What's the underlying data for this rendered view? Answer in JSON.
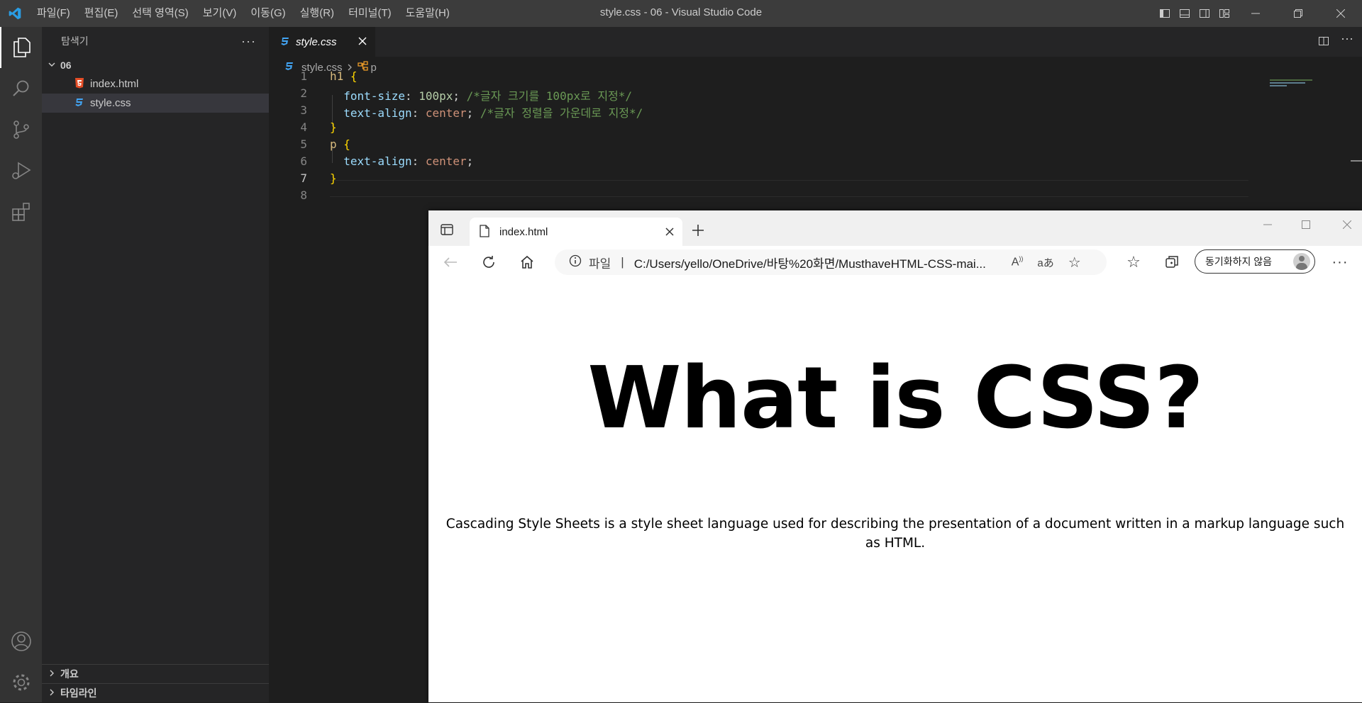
{
  "window": {
    "title": "style.css - 06 - Visual Studio Code"
  },
  "menu": [
    "파일(F)",
    "편집(E)",
    "선택 영역(S)",
    "보기(V)",
    "이동(G)",
    "실행(R)",
    "터미널(T)",
    "도움말(H)"
  ],
  "sidebar": {
    "header": "탐색기",
    "folder": "06",
    "files": [
      {
        "name": "index.html",
        "type": "html"
      },
      {
        "name": "style.css",
        "type": "css",
        "selected": true
      }
    ],
    "sections": [
      "개요",
      "타임라인"
    ]
  },
  "editor": {
    "tab": "style.css",
    "breadcrumb": {
      "file": "style.css",
      "symbol": "p"
    },
    "current_line": 7,
    "lines": [
      {
        "n": "1",
        "tokens": [
          [
            "h1",
            "sel"
          ],
          [
            " ",
            "p"
          ],
          [
            "{",
            "brace"
          ]
        ]
      },
      {
        "n": "2",
        "tokens": [
          [
            "  ",
            "p"
          ],
          [
            "font-size",
            "prop"
          ],
          [
            ": ",
            "p"
          ],
          [
            "100px",
            "num"
          ],
          [
            "; ",
            "p"
          ],
          [
            "/*글자 크기를 100px로 지정*/",
            "com"
          ]
        ]
      },
      {
        "n": "3",
        "tokens": [
          [
            "  ",
            "p"
          ],
          [
            "text-align",
            "prop"
          ],
          [
            ": ",
            "p"
          ],
          [
            "center",
            "val"
          ],
          [
            "; ",
            "p"
          ],
          [
            "/*글자 정렬을 가운데로 지정*/",
            "com"
          ]
        ]
      },
      {
        "n": "4",
        "tokens": [
          [
            "}",
            "brace"
          ]
        ]
      },
      {
        "n": "5",
        "tokens": [
          [
            "p",
            "sel"
          ],
          [
            " ",
            "p"
          ],
          [
            "{",
            "brace"
          ]
        ]
      },
      {
        "n": "6",
        "tokens": [
          [
            "  ",
            "p"
          ],
          [
            "text-align",
            "prop"
          ],
          [
            ": ",
            "p"
          ],
          [
            "center",
            "val"
          ],
          [
            ";",
            "p"
          ]
        ]
      },
      {
        "n": "7",
        "tokens": [
          [
            "}",
            "brace"
          ]
        ]
      },
      {
        "n": "8",
        "tokens": []
      }
    ]
  },
  "browser": {
    "tab_title": "index.html",
    "address_prefix": "파일",
    "address": "C:/Users/yello/OneDrive/바탕%20화면/MusthaveHTML-CSS-mai...",
    "sync_label": "동기화하지 않음",
    "page": {
      "h1": "What is CSS?",
      "p": "Cascading Style Sheets is a style sheet language used for describing the presentation of a document written in a markup language such as HTML."
    }
  },
  "colors": {
    "accent": "#0078d4",
    "css_icon": "#42a5f5",
    "html_icon": "#e44d26"
  },
  "icons": [
    "vscode-logo",
    "files-icon",
    "search-icon",
    "source-control-icon",
    "run-debug-icon",
    "extensions-icon",
    "account-icon",
    "settings-gear-icon"
  ]
}
